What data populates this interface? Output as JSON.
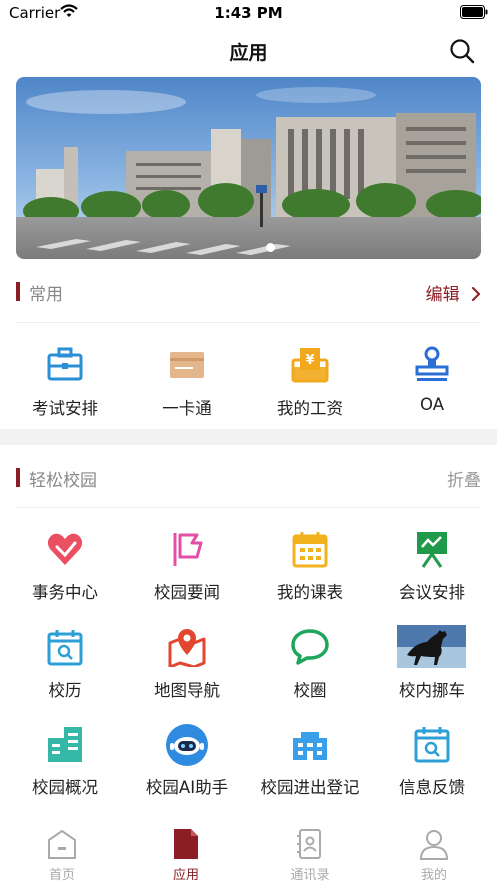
{
  "status": {
    "carrier": "Carrier",
    "time": "1:43 PM"
  },
  "nav": {
    "title": "应用"
  },
  "banner": {
    "page_indicator": {
      "current": 1,
      "total": 1
    }
  },
  "common": {
    "title": "常用",
    "action": "编辑",
    "apps": [
      {
        "label": "考试安排",
        "icon": "briefcase-icon"
      },
      {
        "label": "一卡通",
        "icon": "card-icon"
      },
      {
        "label": "我的工资",
        "icon": "salary-icon"
      },
      {
        "label": "OA",
        "icon": "stamp-icon"
      }
    ]
  },
  "campus": {
    "title": "轻松校园",
    "action": "折叠",
    "apps": [
      {
        "label": "事务中心",
        "icon": "heart-hand-icon"
      },
      {
        "label": "校园要闻",
        "icon": "flag-icon"
      },
      {
        "label": "我的课表",
        "icon": "calendar-icon"
      },
      {
        "label": "会议安排",
        "icon": "presentation-icon"
      },
      {
        "label": "校历",
        "icon": "calendar-search-icon"
      },
      {
        "label": "地图导航",
        "icon": "map-pin-icon"
      },
      {
        "label": "校圈",
        "icon": "chat-bubble-icon"
      },
      {
        "label": "校内挪车",
        "icon": "horse-photo-icon"
      },
      {
        "label": "校园概况",
        "icon": "building-icon"
      },
      {
        "label": "校园AI助手",
        "icon": "robot-icon"
      },
      {
        "label": "校园进出登记",
        "icon": "gate-icon"
      },
      {
        "label": "信息反馈",
        "icon": "feedback-icon"
      }
    ]
  },
  "tabs": [
    {
      "label": "首页",
      "icon": "home-icon",
      "active": false
    },
    {
      "label": "应用",
      "icon": "document-icon",
      "active": true
    },
    {
      "label": "通讯录",
      "icon": "contacts-icon",
      "active": false
    },
    {
      "label": "我的",
      "icon": "user-icon",
      "active": false
    }
  ],
  "colors": {
    "accent": "#8b1e24",
    "blue": "#2b8fd6",
    "tab_inactive": "#aaaaaa"
  }
}
